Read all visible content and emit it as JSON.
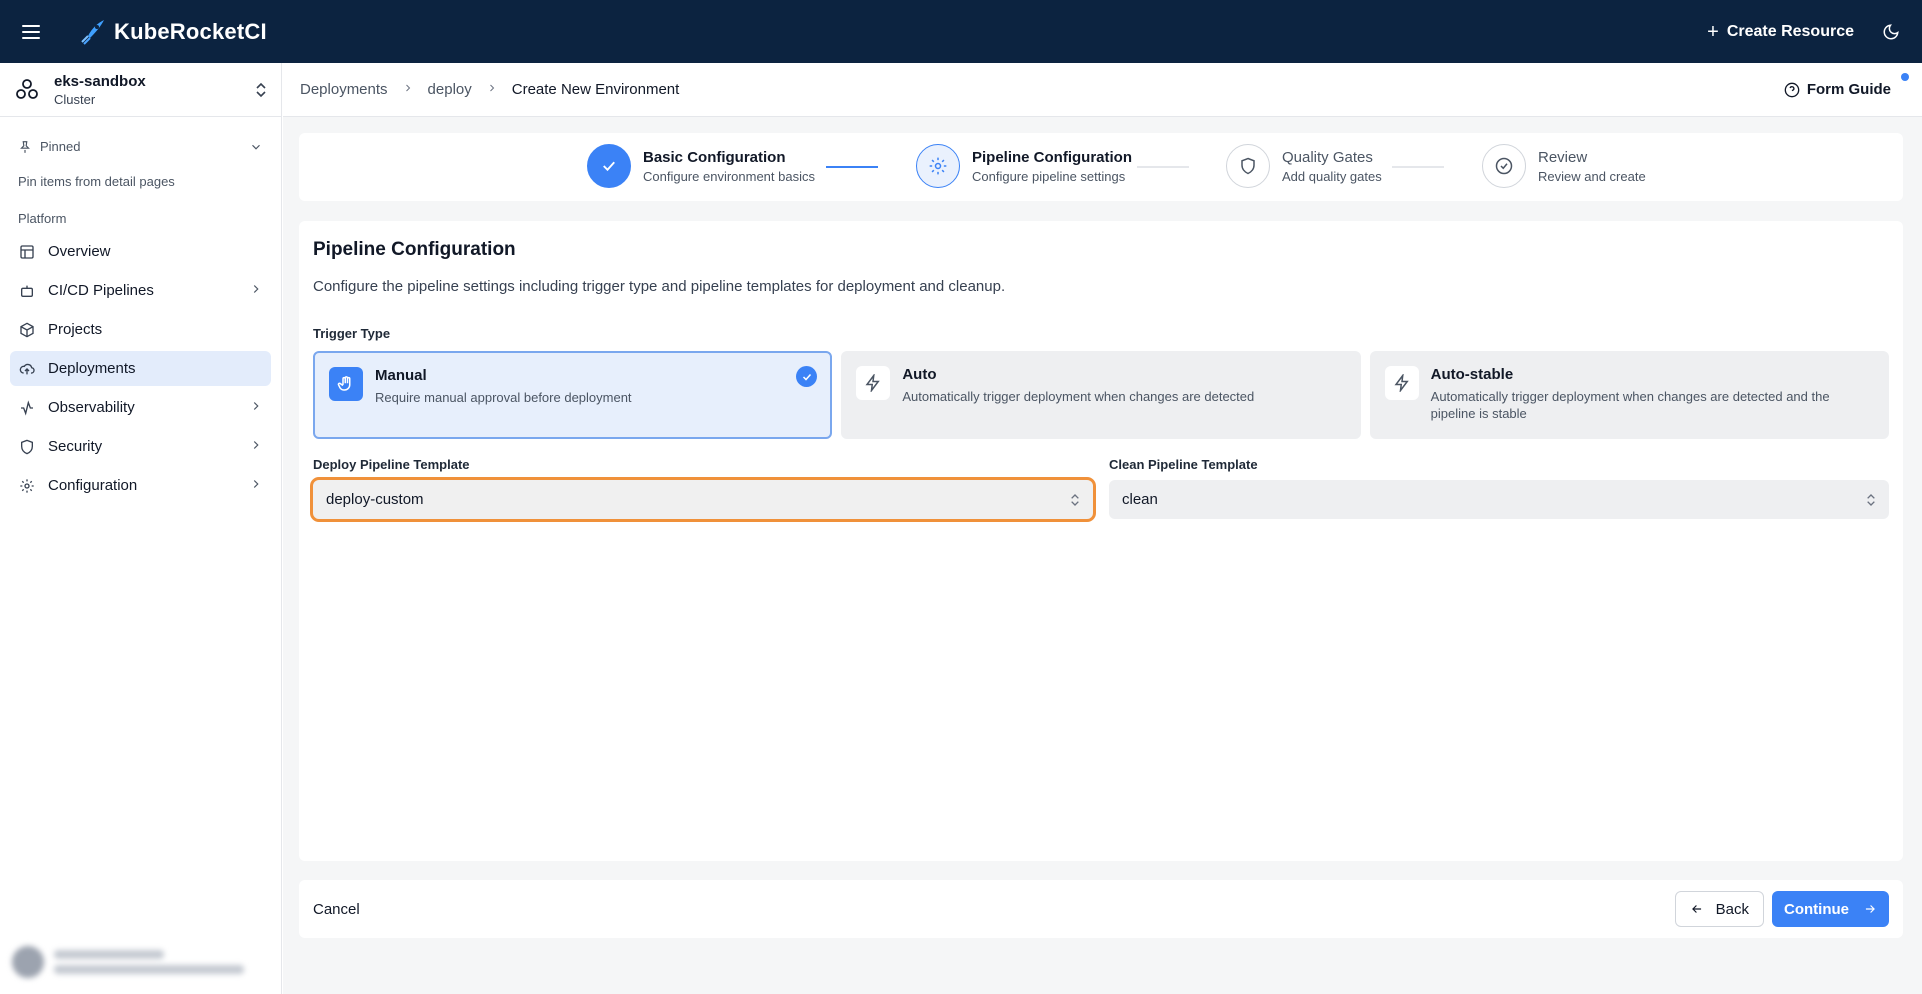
{
  "app": {
    "name": "KubeRocketCI"
  },
  "topbar": {
    "create_label": "Create Resource"
  },
  "cluster": {
    "name": "eks-sandbox",
    "type": "Cluster"
  },
  "sidebar": {
    "pinned_label": "Pinned",
    "pinned_hint": "Pin items from detail pages",
    "section_label": "Platform",
    "items": [
      {
        "label": "Overview",
        "icon": "layout-icon"
      },
      {
        "label": "CI/CD Pipelines",
        "icon": "bot-icon"
      },
      {
        "label": "Projects",
        "icon": "box-icon"
      },
      {
        "label": "Deployments",
        "icon": "cloud-upload-icon"
      },
      {
        "label": "Observability",
        "icon": "activity-icon"
      },
      {
        "label": "Security",
        "icon": "shield-icon"
      },
      {
        "label": "Configuration",
        "icon": "gear-icon"
      }
    ]
  },
  "breadcrumb": [
    "Deployments",
    "deploy",
    "Create New Environment"
  ],
  "header": {
    "form_guide_label": "Form Guide"
  },
  "stepper": [
    {
      "title": "Basic Configuration",
      "subtitle": "Configure environment basics",
      "status": "done"
    },
    {
      "title": "Pipeline Configuration",
      "subtitle": "Configure pipeline settings",
      "status": "current"
    },
    {
      "title": "Quality Gates",
      "subtitle": "Add quality gates",
      "status": "pending"
    },
    {
      "title": "Review",
      "subtitle": "Review and create",
      "status": "pending"
    }
  ],
  "form": {
    "title": "Pipeline Configuration",
    "description": "Configure the pipeline settings including trigger type and pipeline templates for deployment and cleanup.",
    "trigger_label": "Trigger Type",
    "triggers": [
      {
        "title": "Manual",
        "desc": "Require manual approval before deployment",
        "selected": true
      },
      {
        "title": "Auto",
        "desc": "Automatically trigger deployment when changes are detected",
        "selected": false
      },
      {
        "title": "Auto-stable",
        "desc": "Automatically trigger deployment when changes are detected and the pipeline is stable",
        "selected": false
      }
    ],
    "deploy_template_label": "Deploy Pipeline Template",
    "deploy_template_value": "deploy-custom",
    "clean_template_label": "Clean Pipeline Template",
    "clean_template_value": "clean"
  },
  "footer": {
    "cancel_label": "Cancel",
    "back_label": "Back",
    "continue_label": "Continue"
  },
  "colors": {
    "topbar": "#0c2340",
    "accent": "#3b82f6",
    "highlight_outline": "#f0913a"
  }
}
